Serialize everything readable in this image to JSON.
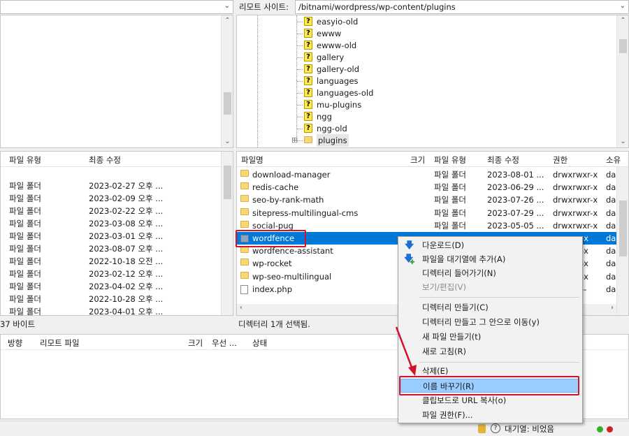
{
  "local": {
    "path_value": "",
    "status": "37 바이트",
    "columns": [
      "파일 유형",
      "최종 수정"
    ],
    "rows": [
      {
        "type": "파일 폴더",
        "modified": "2023-02-27 오후 ..."
      },
      {
        "type": "파일 폴더",
        "modified": "2023-02-09 오후 ..."
      },
      {
        "type": "파일 폴더",
        "modified": "2023-02-22 오후 ..."
      },
      {
        "type": "파일 폴더",
        "modified": "2023-03-08 오후 ..."
      },
      {
        "type": "파일 폴더",
        "modified": "2023-03-01 오후 ..."
      },
      {
        "type": "파일 폴더",
        "modified": "2023-08-07 오후 ..."
      },
      {
        "type": "파일 폴더",
        "modified": "2022-10-18 오전 ..."
      },
      {
        "type": "파일 폴더",
        "modified": "2023-02-12 오후 ..."
      },
      {
        "type": "파일 폴더",
        "modified": "2023-04-02 오후 ..."
      },
      {
        "type": "파일 폴더",
        "modified": "2022-10-28 오후 ..."
      },
      {
        "type": "파일 폴더",
        "modified": "2023-04-01 오후 ..."
      }
    ]
  },
  "remote": {
    "label": "리모트 사이트:",
    "path_value": "/bitnami/wordpress/wp-content/plugins",
    "tree": [
      "easyio-old",
      "ewww",
      "ewww-old",
      "gallery",
      "gallery-old",
      "languages",
      "languages-old",
      "mu-plugins",
      "ngg",
      "ngg-old",
      "plugins"
    ],
    "expand_glyph": "⊞",
    "columns": {
      "name": "파일명",
      "size": "크기",
      "type": "파일 유형",
      "modified": "최종 수정",
      "perm": "권한",
      "owner": "소유"
    },
    "files": [
      {
        "name": "download-manager",
        "type": "파일 폴더",
        "modified": "2023-08-01 ...",
        "perm": "drwxrwxr-x",
        "owner": "dae",
        "icon": "folder"
      },
      {
        "name": "redis-cache",
        "type": "파일 폴더",
        "modified": "2023-06-29 ...",
        "perm": "drwxrwxr-x",
        "owner": "dae",
        "icon": "folder"
      },
      {
        "name": "seo-by-rank-math",
        "type": "파일 폴더",
        "modified": "2023-07-26 ...",
        "perm": "drwxrwxr-x",
        "owner": "dae",
        "icon": "folder"
      },
      {
        "name": "sitepress-multilingual-cms",
        "type": "파일 폴더",
        "modified": "2023-07-29 ...",
        "perm": "drwxrwxr-x",
        "owner": "dae",
        "icon": "folder"
      },
      {
        "name": "social-pug",
        "type": "파일 폴더",
        "modified": "2023-05-05 ...",
        "perm": "drwxrwxr-x",
        "owner": "dae",
        "icon": "folder"
      },
      {
        "name": "wordfence",
        "type": "",
        "modified": "",
        "perm": "-x",
        "owner": "dae",
        "icon": "folder-selected"
      },
      {
        "name": "wordfence-assistant",
        "type": "",
        "modified": "",
        "perm": "-x",
        "owner": "dae",
        "icon": "folder"
      },
      {
        "name": "wp-rocket",
        "type": "",
        "modified": "",
        "perm": "-x",
        "owner": "dae",
        "icon": "folder"
      },
      {
        "name": "wp-seo-multilingual",
        "type": "",
        "modified": "",
        "perm": "-x",
        "owner": "dae",
        "icon": "folder"
      },
      {
        "name": "index.php",
        "type": "",
        "modified": "",
        "perm": "--",
        "owner": "dae",
        "icon": "php-file"
      }
    ],
    "status": "디렉터리 1개 선택됨."
  },
  "queue": {
    "columns": [
      "방향",
      "리모트 파일",
      "크기",
      "우선 ...",
      "상태"
    ]
  },
  "context_menu": {
    "items": [
      {
        "label": "다운로드(D)",
        "icon": "download-arrow-icon",
        "enabled": true
      },
      {
        "label": "파일을 대기열에 추가(A)",
        "icon": "add-queue-icon",
        "enabled": true
      },
      {
        "label": "디렉터리 들어가기(N)",
        "enabled": true
      },
      {
        "label": "보기/편집(V)",
        "enabled": false
      },
      {
        "label": "디렉터리 만들기(C)",
        "enabled": true
      },
      {
        "label": "디렉터리 만들고 그 안으로 이동(y)",
        "enabled": true
      },
      {
        "label": "새 파일 만들기(t)",
        "enabled": true
      },
      {
        "label": "새로 고침(R)",
        "enabled": true
      },
      {
        "label": "삭제(E)",
        "enabled": true
      },
      {
        "label": "이름 바꾸기(R)",
        "enabled": true,
        "highlighted": true
      },
      {
        "label": "클립보드로 URL 복사(o)",
        "enabled": true
      },
      {
        "label": "파일 권한(F)...",
        "enabled": true
      }
    ]
  },
  "statusbar": {
    "queue_label": "대기열: 비었음"
  },
  "colors": {
    "selection": "#0078d7",
    "menu_highlight": "#99ccff",
    "annotation_red": "#d0142c"
  }
}
